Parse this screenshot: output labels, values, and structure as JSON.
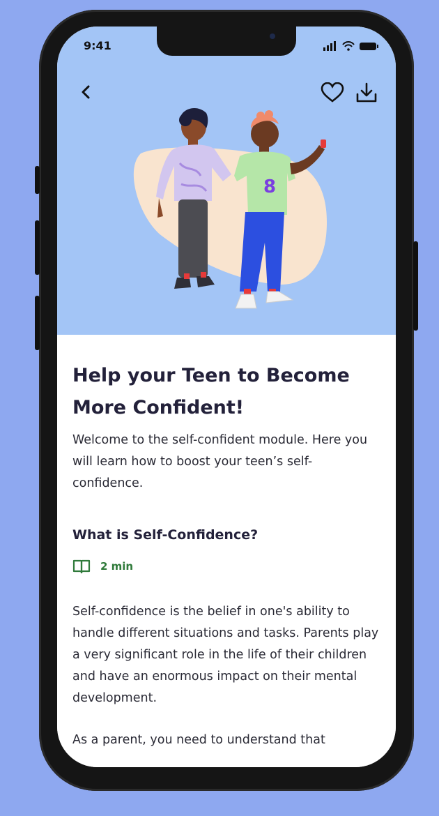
{
  "status_bar": {
    "time": "9:41"
  },
  "article": {
    "title": "Help your Teen to Become More Confident!",
    "intro": "Welcome to the self-confident module. Here you will learn how to boost your teen’s self-confidence.",
    "section_title": "What is Self-Confidence?",
    "read_time": "2 min",
    "body": "Self-confidence is the belief in one's ability to handle different situations and tasks. Parents play a very significant role in the life of their children and have an enormous impact on their mental development.",
    "next_line_partial": "As a parent, you need to understand that"
  },
  "icons": {
    "back": "chevron-left-icon",
    "favorite": "heart-icon",
    "download": "download-icon",
    "read": "book-icon"
  },
  "colors": {
    "background": "#8ea8f0",
    "hero": "#a3c5f6",
    "accent_green": "#2f7a3a",
    "title_text": "#23213a"
  }
}
